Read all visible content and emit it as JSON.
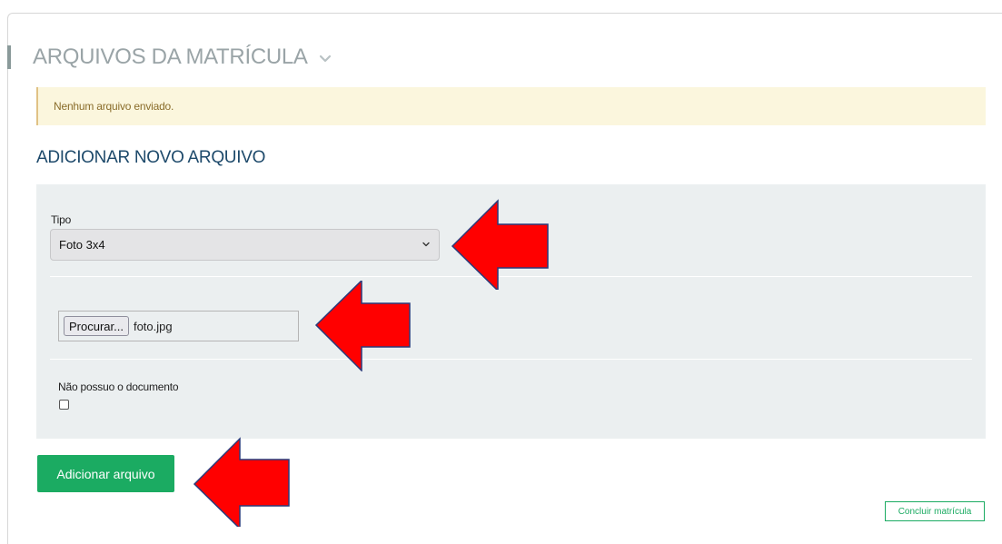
{
  "header": {
    "title": "ARQUIVOS DA MATRÍCULA"
  },
  "alert": {
    "text": "Nenhum arquivo enviado."
  },
  "form": {
    "subtitle": "ADICIONAR NOVO ARQUIVO",
    "type_label": "Tipo",
    "type_value": "Foto 3x4",
    "browse_label": "Procurar...",
    "file_name": "foto.jpg",
    "no_document_label": "Não possuo o documento",
    "no_document_checked": false
  },
  "actions": {
    "add_file": "Adicionar arquivo",
    "finish": "Concluir matrícula"
  },
  "colors": {
    "accent_green": "#1bab62",
    "title_blue": "#1e4a6b",
    "annotation_arrow": "#ff0000"
  },
  "annotations": {
    "arrow_icon": "red-left-arrow",
    "count": 3
  }
}
